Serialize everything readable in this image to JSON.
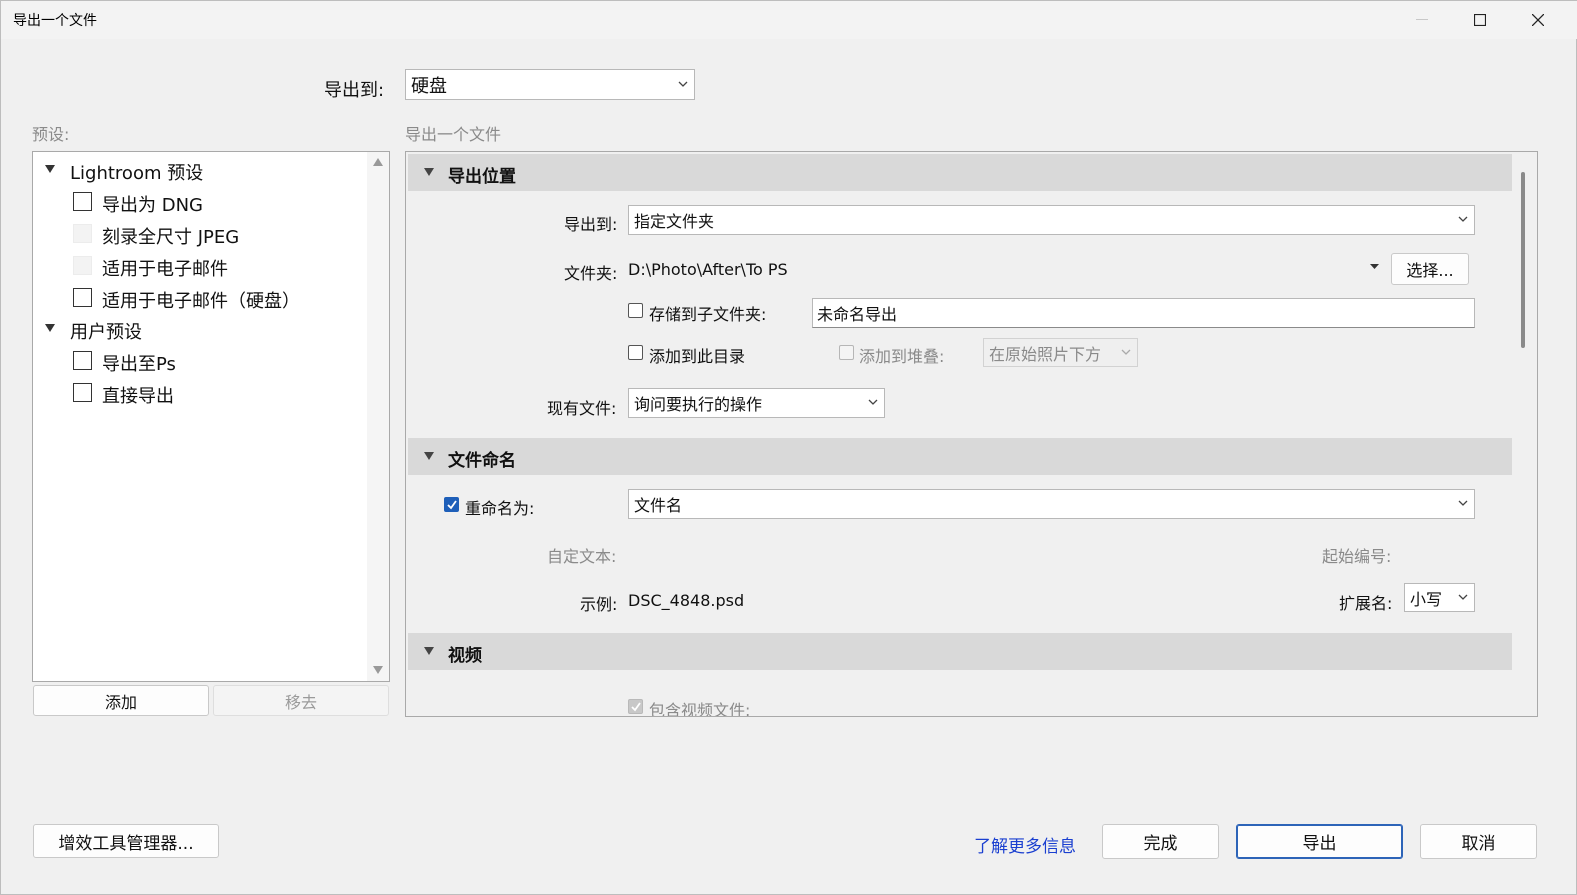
{
  "window": {
    "title": "导出一个文件",
    "controls": [
      "minimize-icon",
      "maximize-icon",
      "close-icon"
    ]
  },
  "top": {
    "export_to_label": "导出到:",
    "export_to_value": "硬盘"
  },
  "presets": {
    "label": "预设:",
    "groups": [
      {
        "name": "Lightroom 预设",
        "items": [
          {
            "label": "导出为 DNG",
            "enabled": true
          },
          {
            "label": "刻录全尺寸 JPEG",
            "enabled": false
          },
          {
            "label": "适用于电子邮件",
            "enabled": false
          },
          {
            "label": "适用于电子邮件（硬盘）",
            "enabled": true
          }
        ]
      },
      {
        "name": "用户预设",
        "items": [
          {
            "label": "导出至Ps",
            "enabled": true
          },
          {
            "label": "直接导出",
            "enabled": true
          }
        ]
      }
    ],
    "add_button": "添加",
    "remove_button": "移去"
  },
  "main": {
    "heading": "导出一个文件",
    "location": {
      "title": "导出位置",
      "export_to_label": "导出到:",
      "export_to_value": "指定文件夹",
      "folder_label": "文件夹:",
      "folder_value": "D:\\Photo\\After\\To PS",
      "choose_button": "选择...",
      "subfolder_label": "存储到子文件夹:",
      "subfolder_checked": false,
      "subfolder_value": "未命名导出",
      "add_to_catalog_label": "添加到此目录",
      "add_to_catalog_checked": false,
      "add_to_stack_label": "添加到堆叠:",
      "stack_position_value": "在原始照片下方",
      "existing_files_label": "现有文件:",
      "existing_files_value": "询问要执行的操作"
    },
    "naming": {
      "title": "文件命名",
      "rename_label": "重命名为:",
      "rename_checked": true,
      "rename_value": "文件名",
      "custom_text_label": "自定文本:",
      "start_number_label": "起始编号:",
      "example_label": "示例:",
      "example_value": "DSC_4848.psd",
      "extension_label": "扩展名:",
      "extension_value": "小写"
    },
    "video": {
      "title": "视频",
      "include_video_label": "包含视频文件:",
      "include_video_checked": true
    }
  },
  "footer": {
    "plugin_manager_button": "增效工具管理器...",
    "learn_more_link": "了解更多信息",
    "done_button": "完成",
    "export_button": "导出",
    "cancel_button": "取消"
  },
  "colors": {
    "accent": "#1e5fb9",
    "link": "#1a3fd0",
    "section_header": "#d9d9d9",
    "background": "#f0f0f0"
  }
}
